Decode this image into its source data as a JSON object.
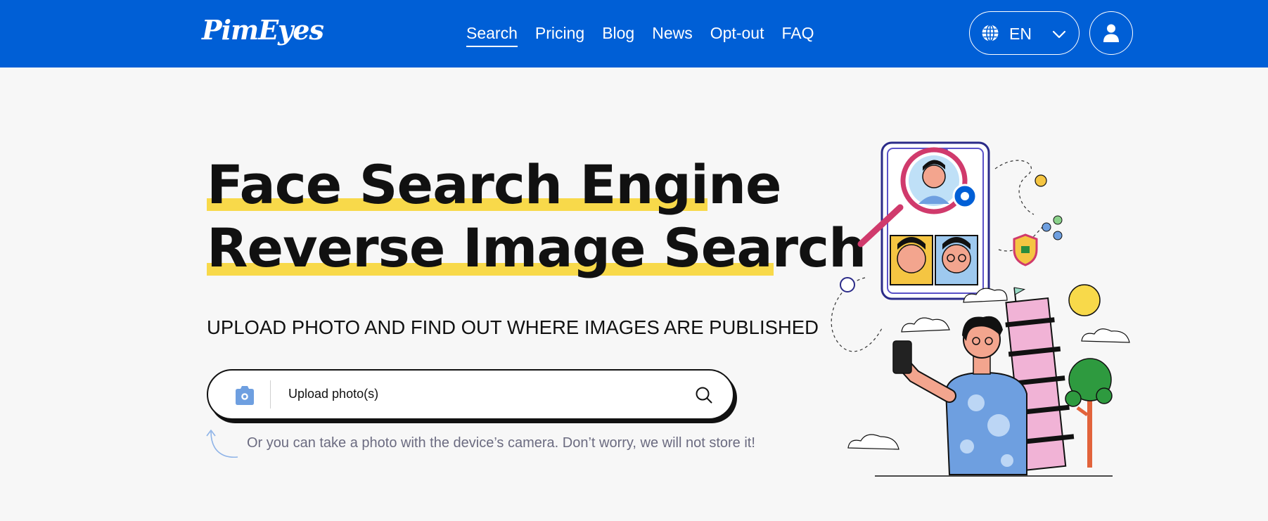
{
  "brand": {
    "logo_text": "PimEyes"
  },
  "nav": {
    "items": [
      "Search",
      "Pricing",
      "Blog",
      "News",
      "Opt-out",
      "FAQ"
    ],
    "active": "Search"
  },
  "header": {
    "language_code": "EN",
    "language_icon": "globe-icon",
    "language_chevron_icon": "chevron-down-icon",
    "account_icon": "user-icon"
  },
  "hero": {
    "title_line1": "Face Search Engine",
    "title_line2": "Reverse Image Search",
    "subtitle": "UPLOAD PHOTO AND FIND OUT WHERE IMAGES ARE PUBLISHED",
    "upload_label": "Upload photo(s)",
    "upload_icon": "camera-icon",
    "search_icon": "search-icon",
    "hint": "Or you can take a photo with the device’s camera. Don’t worry, we will not store it!"
  },
  "colors": {
    "header_bg": "#005fd6",
    "highlight": "#f8d94a",
    "page_bg": "#f7f7f7",
    "text": "#111111",
    "hint_text": "#6b6b80"
  }
}
